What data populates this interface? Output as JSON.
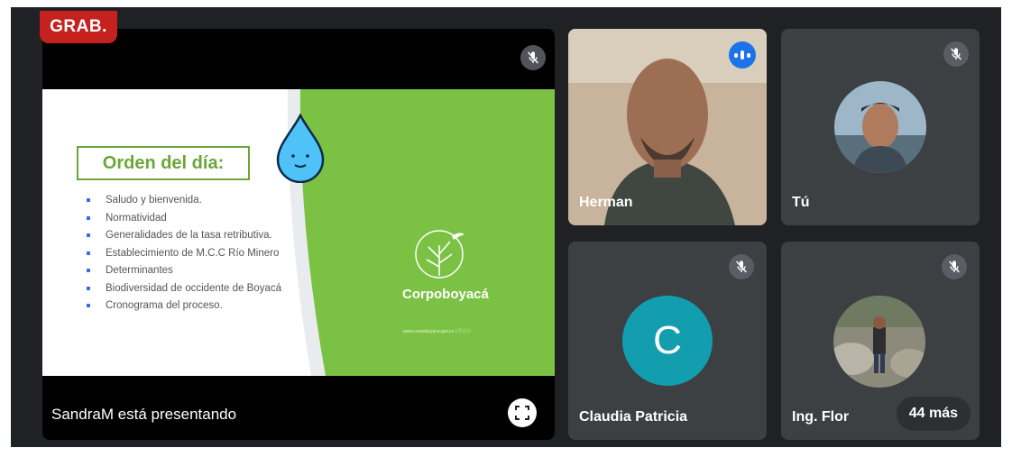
{
  "meeting": {
    "recording_label": "GRAB.",
    "presenter_label": "SandraM está presentando"
  },
  "slide": {
    "title": "Orden del día:",
    "items": [
      "Saludo y bienvenida.",
      "Normatividad",
      "Generalidades de la tasa retributiva.",
      "Establecimiento de M.C.C Río Minero",
      "Determinantes",
      "Biodiversidad de occidente de Boyacá",
      "Cronograma del proceso."
    ],
    "brand": "Corpoboyacá",
    "brand_url": "www.corpoboyaca.gov.co | ⓕⓣⓘ"
  },
  "participants": [
    {
      "name": "Herman",
      "state": "speaking"
    },
    {
      "name": "Tú",
      "state": "muted"
    },
    {
      "name": "Claudia Patricia",
      "state": "muted",
      "avatar_letter": "C"
    },
    {
      "name": "Ing. Flor",
      "state": "muted"
    }
  ],
  "more_participants": "44 más",
  "colors": {
    "background": "#202124",
    "tile": "#3c4043",
    "recording": "#c5221f",
    "speaking": "#1a73e8",
    "avatar_c": "#129eaf",
    "slide_green": "#7bc143"
  },
  "icons": [
    "mic-off-icon",
    "speaking-indicator-icon",
    "fullscreen-icon",
    "water-drop-mascot",
    "corpoboyaca-logo-icon"
  ]
}
